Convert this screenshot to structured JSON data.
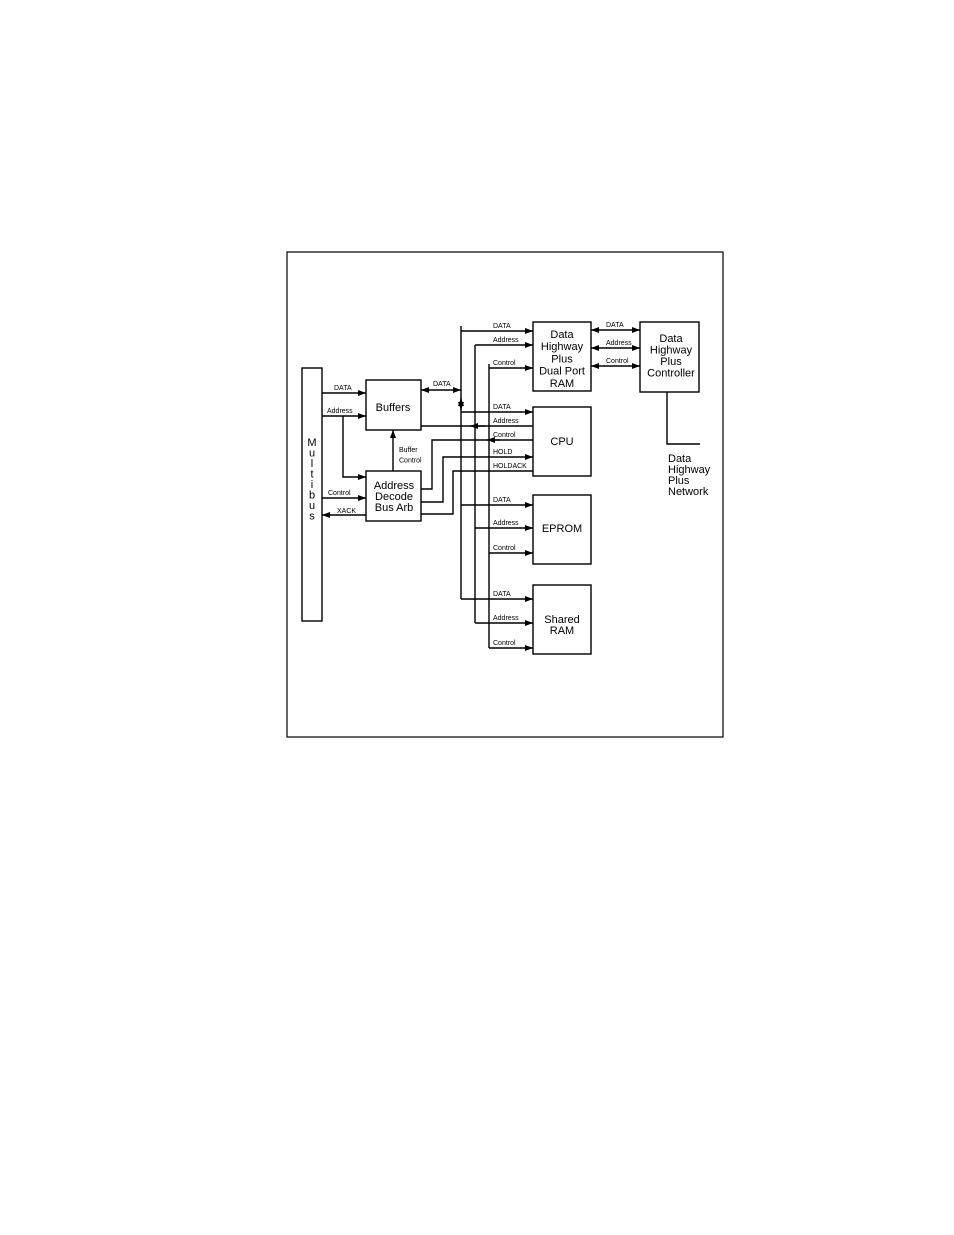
{
  "blocks": {
    "multibus": "Multibus",
    "buffers": "Buffers",
    "address_decode": [
      "Address",
      "Decode",
      "Bus Arb"
    ],
    "dhp_ram": [
      "Data",
      "Highway",
      "Plus",
      "Dual Port",
      "RAM"
    ],
    "cpu": "CPU",
    "eprom": "EPROM",
    "shared_ram": [
      "Shared",
      "RAM"
    ],
    "controller": [
      "Data",
      "Highway",
      "Plus",
      "Controller"
    ],
    "network": [
      "Data",
      "Highway",
      "Plus",
      "Network"
    ]
  },
  "signals": {
    "data": "DATA",
    "address": "Address",
    "control": "Control",
    "xack": "XACK",
    "buffer_control": [
      "Buffer",
      "Control"
    ],
    "hold": "HOLD",
    "holdack": "HOLDACK"
  }
}
